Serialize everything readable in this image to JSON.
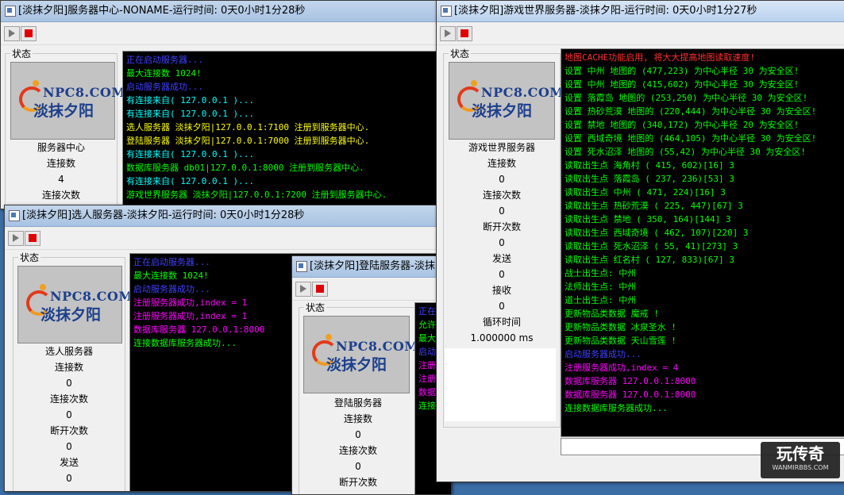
{
  "windows": {
    "center": {
      "title": "[淡抹夕阳]服务器中心-NONAME-运行时间: 0天0小时1分28秒",
      "group_label": "状态",
      "logo": {
        "npc": "NPC8.COM",
        "brand": "淡抹夕阳"
      },
      "stats": [
        "服务器中心",
        "连接数",
        "4",
        "连接次数"
      ],
      "log": [
        {
          "text": "正在启动服务器...",
          "color": "#4040ff"
        },
        {
          "text": "最大连接数 1024!",
          "color": "#00ff00"
        },
        {
          "text": "启动服务器成功...",
          "color": "#4040ff"
        },
        {
          "text": "有连接来自( 127.0.0.1 )...",
          "color": "#00ffff"
        },
        {
          "text": "有连接来自( 127.0.0.1 )...",
          "color": "#00ffff"
        },
        {
          "text": "选人服务器 淡抹夕阳|127.0.0.1:7100 注册到服务器中心.",
          "color": "#ffff00"
        },
        {
          "text": "登陆服务器 淡抹夕阳|127.0.0.1:7000 注册到服务器中心.",
          "color": "#ffff00"
        },
        {
          "text": "有连接来自( 127.0.0.1 )...",
          "color": "#00ffff"
        },
        {
          "text": "数据库服务器 db01|127.0.0.1:8000 注册到服务器中心.",
          "color": "#00ff00"
        },
        {
          "text": "有连接来自( 127.0.0.1 )...",
          "color": "#00ffff"
        },
        {
          "text": "游戏世界服务器 淡抹夕阳|127.0.0.1:7200 注册到服务器中心.",
          "color": "#00ff00"
        }
      ]
    },
    "select": {
      "title": "[淡抹夕阳]选人服务器-淡抹夕阳-运行时间: 0天0小时1分28秒",
      "group_label": "状态",
      "logo": {
        "npc": "NPC8.COM",
        "brand": "淡抹夕阳"
      },
      "stats": [
        "选人服务器",
        "连接数",
        "0",
        "连接次数",
        "0",
        "断开次数",
        "0",
        "发送",
        "0"
      ],
      "log": [
        {
          "text": "正在启动服务器...",
          "color": "#4040ff"
        },
        {
          "text": "最大连接数 1024!",
          "color": "#00ff00"
        },
        {
          "text": "启动服务器成功...",
          "color": "#4040ff"
        },
        {
          "text": "注册服务器成功,index = 1",
          "color": "#ff00ff"
        },
        {
          "text": "注册服务器成功,index = 1",
          "color": "#ff00ff"
        },
        {
          "text": "数据库服务器 127.0.0.1:8000",
          "color": "#ff00ff"
        },
        {
          "text": "连接数据库服务器成功...",
          "color": "#00ff00"
        }
      ]
    },
    "login": {
      "title": "[淡抹夕阳]登陆服务器-淡抹夕",
      "group_label": "状态",
      "logo": {
        "npc": "NPC8.COM",
        "brand": "淡抹夕阳"
      },
      "stats": [
        "登陆服务器",
        "连接数",
        "0",
        "连接次数",
        "0",
        "断开次数"
      ],
      "log": [
        {
          "text": "正在",
          "color": "#4040ff"
        },
        {
          "text": "允许",
          "color": "#00ff00"
        },
        {
          "text": "最大",
          "color": "#00ff00"
        },
        {
          "text": "启动",
          "color": "#4040ff"
        },
        {
          "text": "注册",
          "color": "#ff00ff"
        },
        {
          "text": "注册",
          "color": "#ff00ff"
        },
        {
          "text": "数据",
          "color": "#ff00ff"
        },
        {
          "text": "连接",
          "color": "#00ff00"
        }
      ]
    },
    "world": {
      "title": "[淡抹夕阳]游戏世界服务器-淡抹夕阳-运行时间: 0天0小时1分27秒",
      "group_label": "状态",
      "logo": {
        "npc": "NPC8.COM",
        "brand": "淡抹夕阳"
      },
      "stats": [
        "游戏世界服务器",
        "连接数",
        "0",
        "连接次数",
        "0",
        "断开次数",
        "0",
        "发送",
        "0",
        "接收",
        "0",
        "循环时间",
        "1.000000 ms"
      ],
      "log": [
        {
          "text": "地图CACHE功能启用, 将大大提高地图读取速度!",
          "color": "#ff3030"
        },
        {
          "text": "设置 中州 地图的 (477,223) 为中心半径 30 为安全区!",
          "color": "#00ff00"
        },
        {
          "text": "设置 中州 地图的 (415,602) 为中心半径 30 为安全区!",
          "color": "#00ff00"
        },
        {
          "text": "设置 落霞岛 地图的 (253,250) 为中心半径 30 为安全区!",
          "color": "#00ff00"
        },
        {
          "text": "设置 热砂荒漠 地图的 (220,444) 为中心半径 30 为安全区!",
          "color": "#00ff00"
        },
        {
          "text": "设置 禁地 地图的 (340,172) 为中心半径 20 为安全区!",
          "color": "#00ff00"
        },
        {
          "text": "设置 西域奇境 地图的 (464,105) 为中心半径 30 为安全区!",
          "color": "#00ff00"
        },
        {
          "text": "设置 死水沼泽 地图的 (55,42) 为中心半径 30 为安全区!",
          "color": "#00ff00"
        },
        {
          "text": "读取出生点 海角村 ( 415, 602)[16] 3",
          "color": "#00ff00"
        },
        {
          "text": "读取出生点 落霞岛 ( 237, 236)[53] 3",
          "color": "#00ff00"
        },
        {
          "text": "读取出生点 中州 ( 471, 224)[16] 3",
          "color": "#00ff00"
        },
        {
          "text": "读取出生点 热砂荒漠 ( 225, 447)[67] 3",
          "color": "#00ff00"
        },
        {
          "text": "读取出生点 禁地 ( 350, 164)[144] 3",
          "color": "#00ff00"
        },
        {
          "text": "读取出生点 西域奇境 ( 462, 107)[220] 3",
          "color": "#00ff00"
        },
        {
          "text": "读取出生点 死水沼泽 ( 55, 41)[273] 3",
          "color": "#00ff00"
        },
        {
          "text": "读取出生点 红名村 ( 127, 833)[67] 3",
          "color": "#00ff00"
        },
        {
          "text": "战士出生点: 中州",
          "color": "#00ff00"
        },
        {
          "text": "法师出生点: 中州",
          "color": "#00ff00"
        },
        {
          "text": "道士出生点: 中州",
          "color": "#00ff00"
        },
        {
          "text": "更新物品类数据 魔戒 !",
          "color": "#00ff00"
        },
        {
          "text": "更新物品类数据 冰泉圣水 !",
          "color": "#00ff00"
        },
        {
          "text": "更新物品类数据 天山雪莲 !",
          "color": "#00ff00"
        },
        {
          "text": "启动服务器成功...",
          "color": "#4040ff"
        },
        {
          "text": "注册服务器成功,index = 4",
          "color": "#ff00ff"
        },
        {
          "text": "数据库服务器 127.0.0.1:8000",
          "color": "#ff00ff"
        },
        {
          "text": "数据库服务器 127.0.0.1:8000",
          "color": "#ff00ff"
        },
        {
          "text": "连接数据库服务器成功...",
          "color": "#00ff00"
        }
      ]
    }
  },
  "watermark": {
    "big": "玩传奇",
    "small": "WANMIRBBS.COM"
  }
}
